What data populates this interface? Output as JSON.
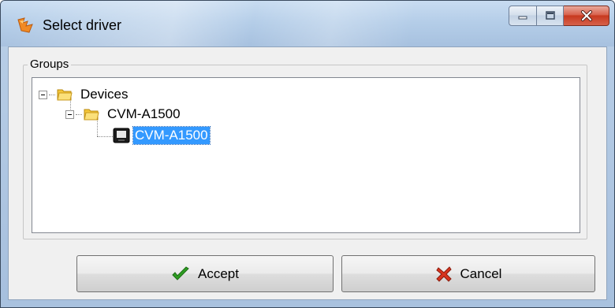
{
  "window": {
    "title": "Select driver",
    "icon": "app-icon"
  },
  "caption_buttons": {
    "minimize": "minimize-icon",
    "maximize": "maximize-icon",
    "close": "close-icon"
  },
  "groups": {
    "label": "Groups",
    "tree": [
      {
        "label": "Devices",
        "icon": "folder-icon",
        "expanded": true,
        "level": 0
      },
      {
        "label": "CVM-A1500",
        "icon": "folder-icon",
        "expanded": true,
        "level": 1
      },
      {
        "label": "CVM-A1500",
        "icon": "device-icon",
        "selected": true,
        "level": 2
      }
    ]
  },
  "buttons": {
    "accept_label": "Accept",
    "cancel_label": "Cancel"
  },
  "colors": {
    "selection": "#3399ff",
    "accept_icon": "#2e9e22",
    "cancel_icon": "#d8341e"
  }
}
